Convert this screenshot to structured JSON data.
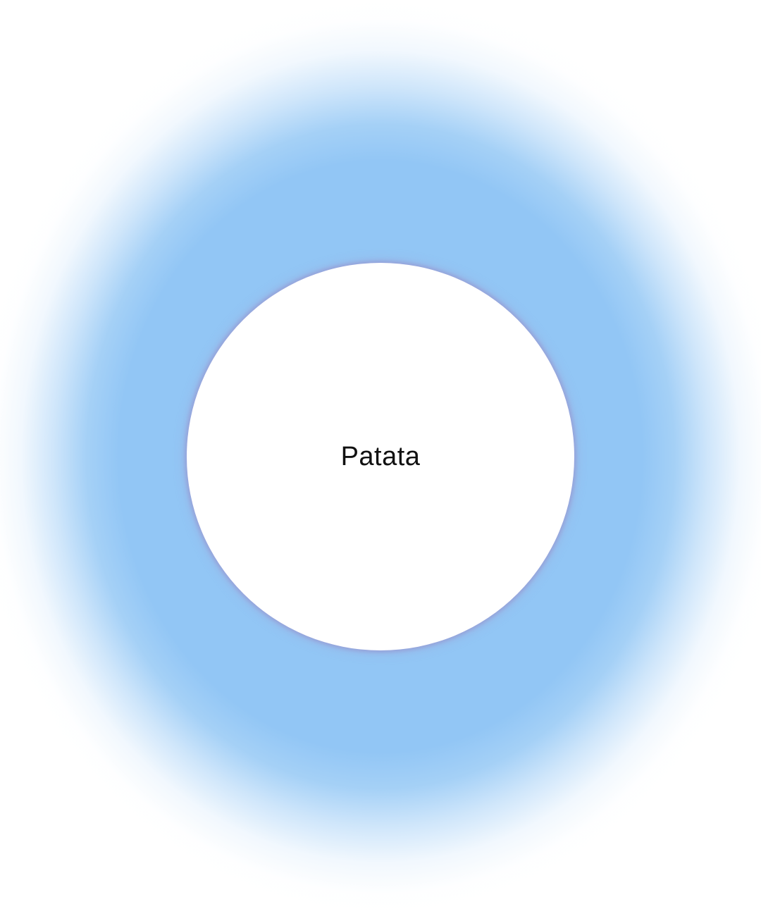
{
  "main": {
    "button_label": "Patata"
  },
  "colors": {
    "halo": "#92C6F5",
    "circle": "#FFFFFF",
    "circle_edge": "#A9A3C9",
    "text": "#111111",
    "background": "#FFFFFF"
  }
}
